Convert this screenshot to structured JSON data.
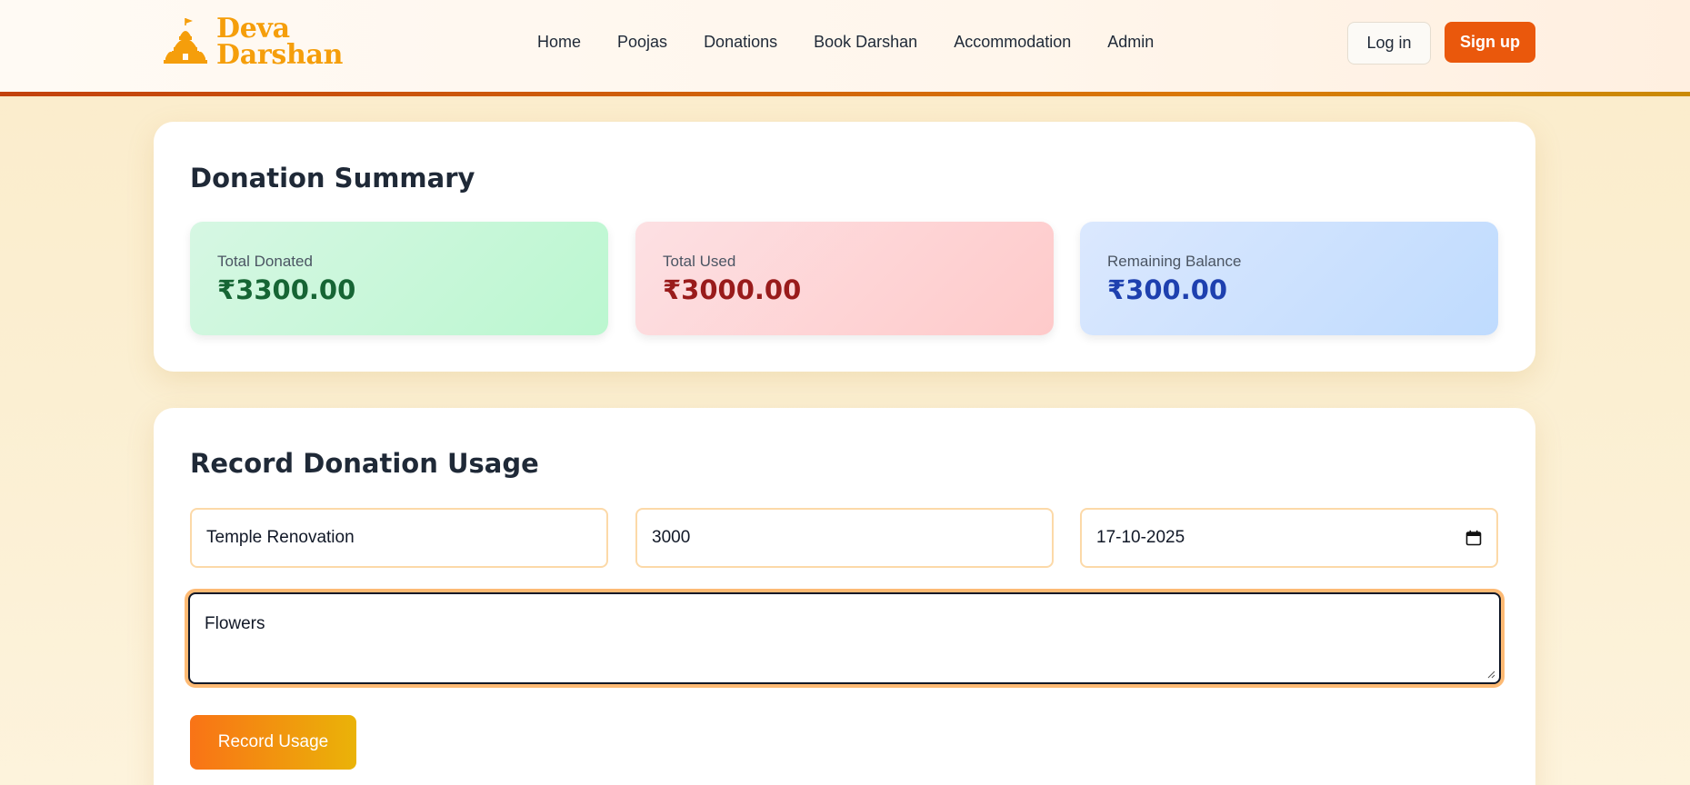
{
  "brand": {
    "line1": "Deva",
    "line2": "Darshan",
    "logo_icon": "temple-icon"
  },
  "nav": [
    {
      "label": "Home"
    },
    {
      "label": "Poojas"
    },
    {
      "label": "Donations"
    },
    {
      "label": "Book Darshan"
    },
    {
      "label": "Accommodation"
    },
    {
      "label": "Admin"
    }
  ],
  "auth": {
    "login": "Log in",
    "signup": "Sign up"
  },
  "summary": {
    "title": "Donation Summary",
    "stats": [
      {
        "label": "Total Donated",
        "value": "₹3300.00",
        "color": "#166534"
      },
      {
        "label": "Total Used",
        "value": "₹3000.00",
        "color": "#991b1b"
      },
      {
        "label": "Remaining Balance",
        "value": "₹300.00",
        "color": "#1e40af"
      }
    ]
  },
  "usage": {
    "title": "Record Donation Usage",
    "purpose_value": "Temple Renovation",
    "amount_value": "3000",
    "date_value": "17-10-2025",
    "date_icon": "calendar-icon",
    "notes_value": "Flowers",
    "submit_label": "Record Usage"
  },
  "colors": {
    "accent": "#ea580c",
    "brand": "#f59e0b"
  }
}
